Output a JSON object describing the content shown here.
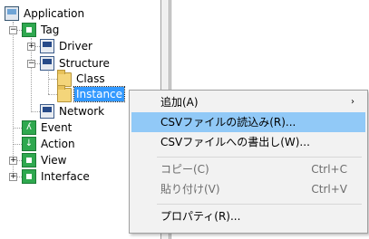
{
  "tree": {
    "root": "Application",
    "items": {
      "tag": "Tag",
      "driver": "Driver",
      "structure": "Structure",
      "class": "Class",
      "instance": "Instance",
      "network": "Network",
      "event": "Event",
      "action": "Action",
      "view": "View",
      "interface": "Interface"
    },
    "expander_plus": "+",
    "expander_minus": "−"
  },
  "context_menu": {
    "add": "追加(A)",
    "add_arrow": "›",
    "csv_import": "CSVファイルの読込み(R)...",
    "csv_export": "CSVファイルへの書出し(W)...",
    "copy": "コピー(C)",
    "copy_shortcut": "Ctrl+C",
    "paste": "貼り付け(V)",
    "paste_shortcut": "Ctrl+V",
    "properties": "プロパティ(R)..."
  },
  "colors": {
    "selection": "#3399ff",
    "menu_hover": "#91c9f7",
    "disabled_text": "#6d6d6d"
  }
}
